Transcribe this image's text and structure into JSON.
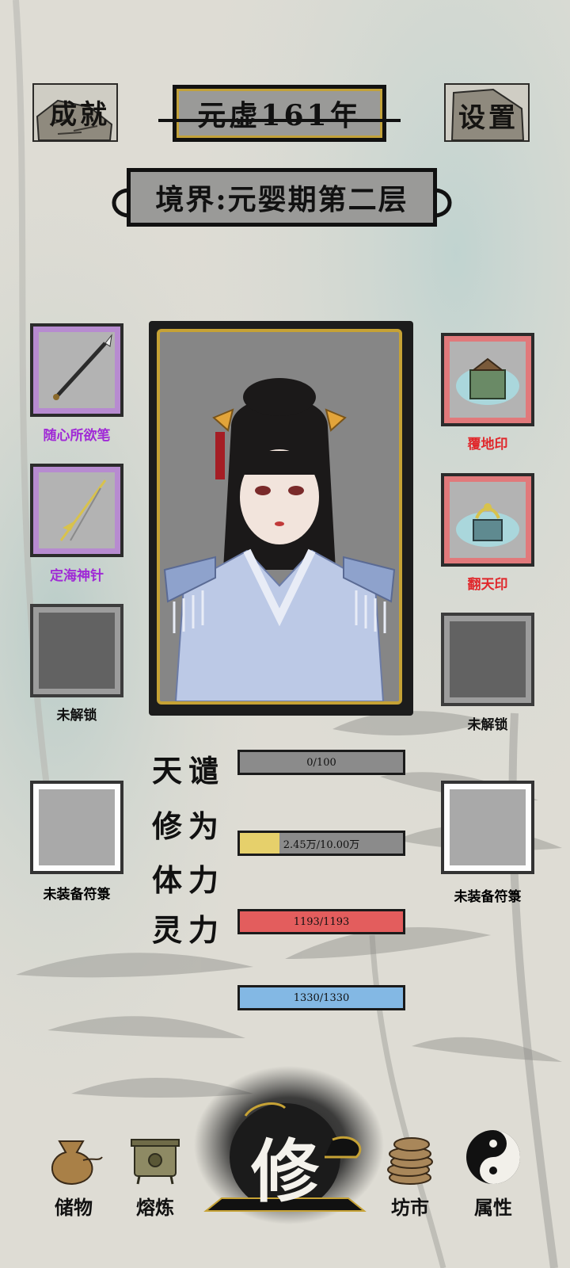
{
  "header": {
    "achievements_label": "成就",
    "settings_label": "设置",
    "year": "元虚161年",
    "realm": "境界:元婴期第二层"
  },
  "left_slots": [
    {
      "label": "随心所欲笔",
      "color": "#a02ad6",
      "state": "equipped"
    },
    {
      "label": "定海神针",
      "color": "#a02ad6",
      "state": "equipped"
    },
    {
      "label": "未解锁",
      "color": "#111111",
      "state": "locked"
    }
  ],
  "right_slots": [
    {
      "label": "覆地印",
      "color": "#e0282c",
      "state": "equipped"
    },
    {
      "label": "翻天印",
      "color": "#e0282c",
      "state": "equipped"
    },
    {
      "label": "未解锁",
      "color": "#111111",
      "state": "locked"
    }
  ],
  "talisman_slots": {
    "left_label": "未装备符箓",
    "right_label": "未装备符箓"
  },
  "stats": [
    {
      "name": "天谴",
      "value": "0/100",
      "fill": 0,
      "color": "#8b8b8b"
    },
    {
      "name": "修为",
      "value": "2.45万/10.00万",
      "fill": 0.245,
      "color": "#e6d06b"
    },
    {
      "name": "体力",
      "value": "1193/1193",
      "fill": 1,
      "color": "#e35d5d"
    },
    {
      "name": "灵力",
      "value": "1330/1330",
      "fill": 1,
      "color": "#83b8e4"
    }
  ],
  "nav": {
    "storage": "储物",
    "refine": "熔炼",
    "cultivate": "修",
    "market": "坊市",
    "attributes": "属性"
  }
}
